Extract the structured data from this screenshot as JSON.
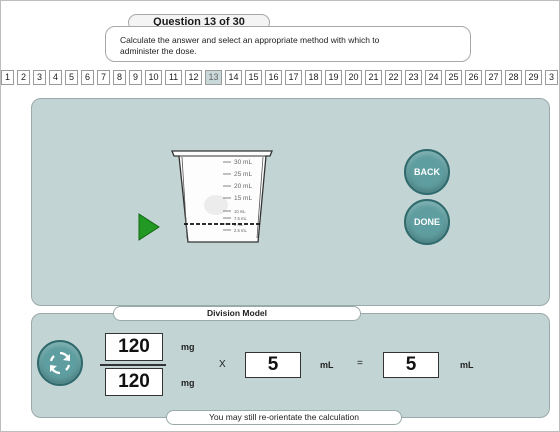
{
  "question": {
    "title": "Question 13 of 30",
    "prompt_line1": "Calculate the answer and select an appropriate method with which to",
    "prompt_line2": "administer the dose."
  },
  "question_numbers": {
    "items": [
      "1",
      "2",
      "3",
      "4",
      "5",
      "6",
      "7",
      "8",
      "9",
      "10",
      "11",
      "12",
      "13",
      "14",
      "15",
      "16",
      "17",
      "18",
      "19",
      "20",
      "21",
      "22",
      "23",
      "24",
      "25",
      "26",
      "27",
      "28",
      "29",
      "3"
    ],
    "active": "13"
  },
  "measuring_cup": {
    "markings": [
      "30 mL",
      "25 mL",
      "20 mL",
      "15 mL",
      "10 mL",
      "7.5 mL",
      "5 mL",
      "2.5 mL"
    ],
    "fill_level_ml": 5
  },
  "buttons": {
    "back": "BACK",
    "done": "DONE"
  },
  "labels": {
    "division_model": "Division Model",
    "reorient_note": "You may still re-orientate the calculation"
  },
  "calculation": {
    "numerator": "120",
    "numerator_unit": "mg",
    "denominator": "120",
    "denominator_unit": "mg",
    "multiply_sign": "X",
    "volume": "5",
    "volume_unit": "mL",
    "equals_sign": "=",
    "result": "5",
    "result_unit": "mL"
  },
  "icons": {
    "play": "play-icon",
    "refresh": "refresh-icon"
  },
  "colors": {
    "panel": "#c3d4d4",
    "button": "#5f9ea0",
    "play": "#229922"
  }
}
